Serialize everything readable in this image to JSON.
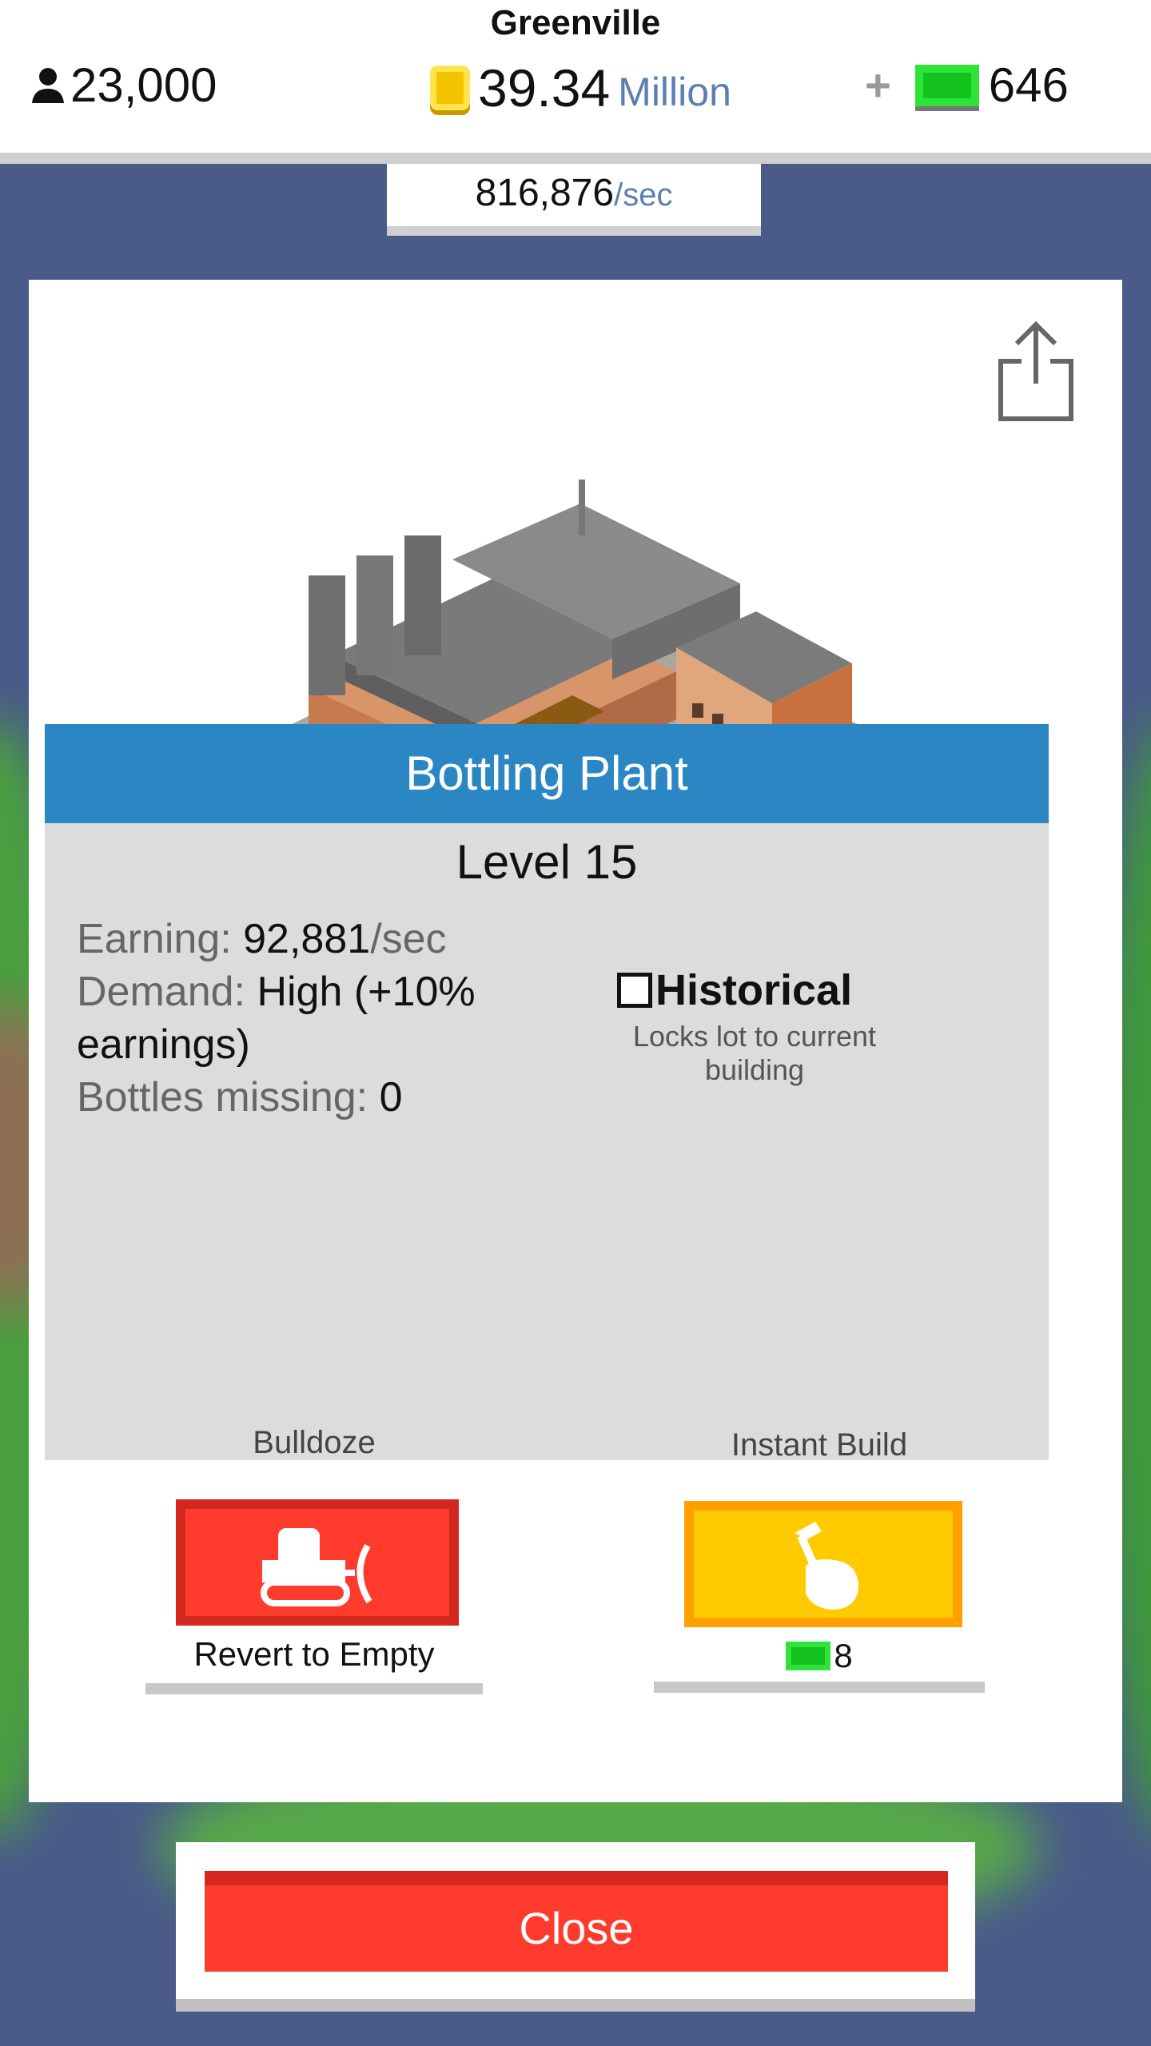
{
  "header": {
    "city_name": "Greenville",
    "population": "23,000",
    "money_value": "39.34",
    "money_unit": "Million",
    "plus_label": "+",
    "cash_value": "646",
    "rate_value": "816,876",
    "rate_unit": "/sec"
  },
  "building": {
    "name": "Bottling Plant",
    "level": "Level 15",
    "earning_label": "Earning:",
    "earning_value": "92,881",
    "earning_unit": "/sec",
    "demand_label": "Demand:",
    "demand_value": "High (+10% earnings)",
    "bottles_label": "Bottles missing:",
    "bottles_value": "0"
  },
  "historical": {
    "label": "Historical",
    "description": "Locks lot to current building",
    "checked": false
  },
  "actions": {
    "bulldoze_label": "Bulldoze",
    "bulldoze_caption": "Revert to Empty",
    "instant_label": "Instant Build",
    "instant_cost": "8"
  },
  "close_label": "Close",
  "colors": {
    "header_accent": "#5a7fb0",
    "title_bar": "#2b86c4",
    "close_red": "#ff3b2e",
    "instant_yellow": "#ffcb00",
    "cash_green": "#14c21e"
  }
}
